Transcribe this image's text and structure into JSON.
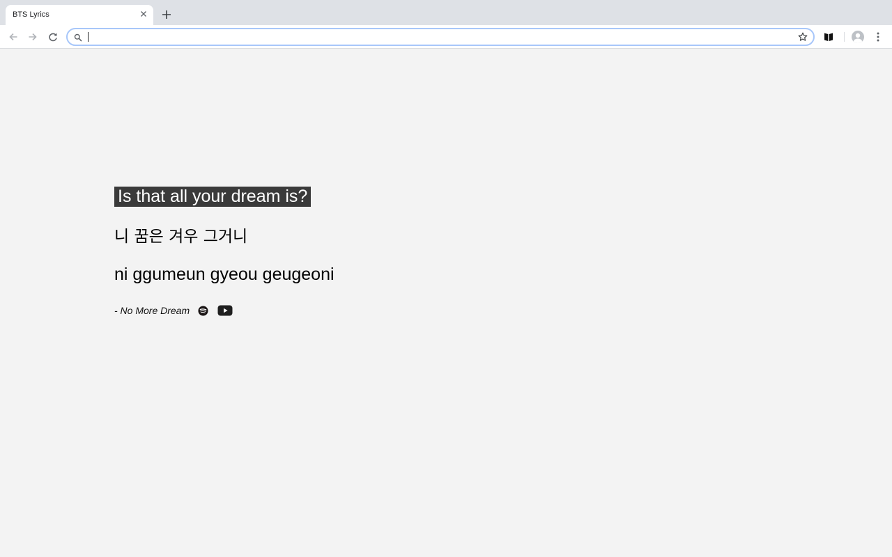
{
  "browser": {
    "tab": {
      "title": "BTS Lyrics"
    },
    "omnibox": {
      "value": ""
    },
    "icons": {
      "tab_close": "close-icon",
      "new_tab": "plus-icon",
      "back": "arrow-left-icon",
      "forward": "arrow-right-icon",
      "reload": "reload-icon",
      "search": "search-icon",
      "bookmark": "star-icon",
      "extension": "book-icon",
      "profile": "avatar-icon",
      "menu": "kebab-menu-icon"
    }
  },
  "lyric": {
    "english": "Is that all your dream is?",
    "korean": "니 꿈은 겨우 그거니",
    "romanized": "ni ggumeun gyeou geugeoni",
    "song": "- No More Dream"
  },
  "links": {
    "spotify": "spotify-icon",
    "youtube": "youtube-icon"
  },
  "colors": {
    "page_background": "#f3f3f3",
    "highlight_background": "#3a3a3a",
    "highlight_text": "#ffffff",
    "tabstrip": "#dee1e6",
    "omnibox_focus": "#a8c7fa"
  }
}
